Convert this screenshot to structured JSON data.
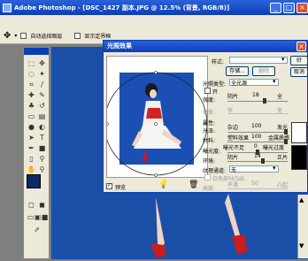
{
  "window": {
    "title": "Adobe Photoshop - [DSC_1427 副本.JPG @ 12.5% (背景, RGB/8)]"
  },
  "optbar": {
    "auto_select": "自动选择图层",
    "show_bounds": "显示定界框"
  },
  "dialog": {
    "title": "光照效果",
    "style_label": "样式:",
    "save": "存储...",
    "delete": "删除",
    "ok": "好",
    "cancel": "取消",
    "light_type_label": "光照类型:",
    "light_type_value": "全光源",
    "on_label": "开",
    "intensity_label": "强度:",
    "intensity_left": "阴片",
    "intensity_value": "18",
    "intensity_right": "全",
    "focus_label": "聚焦:",
    "focus_left": "窄",
    "focus_right": "宽",
    "properties_label": "属性:",
    "gloss_label": "光泽:",
    "gloss_left": "杂边",
    "gloss_value": "100",
    "gloss_right": "发光",
    "material_label": "材料:",
    "material_left": "塑料效果",
    "material_value": "100",
    "material_right": "金属质感",
    "exposure_label": "曝光度:",
    "exposure_left": "曝光不足",
    "exposure_value": "0",
    "exposure_right": "曝光过度",
    "ambience_label": "环境:",
    "ambience_left": "阴片",
    "ambience_value": "14",
    "ambience_right": "正片",
    "texture_label": "纹理通道:",
    "texture_value": "无",
    "white_high_label": "白色部分凸出",
    "height_label": "高度:",
    "height_left": "平滑",
    "height_value": "50",
    "height_right": "凸起",
    "preview_label": "预览"
  },
  "colors": {
    "accent": "#0a3fb8",
    "canvas": "#1a4fa8",
    "photo_bg": "#1b4fb3"
  }
}
